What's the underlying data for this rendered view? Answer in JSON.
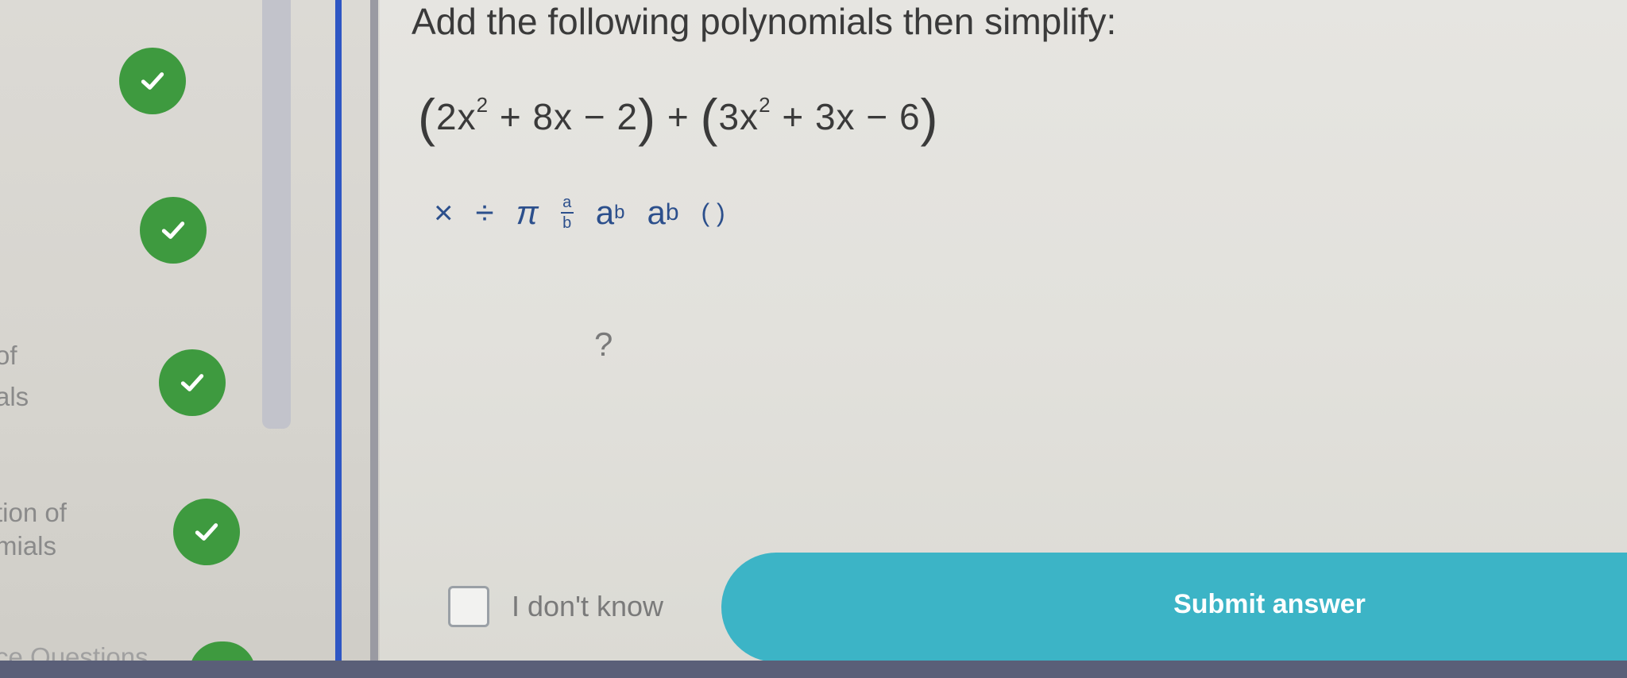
{
  "sidebar": {
    "lessons": [
      {
        "label_lines": [
          ""
        ],
        "completed": true
      },
      {
        "label_lines": [
          ""
        ],
        "completed": true
      },
      {
        "label_lines": [
          "of",
          "als"
        ],
        "completed": true
      },
      {
        "label_lines": [
          "tion of",
          "mials"
        ],
        "completed": true
      },
      {
        "label_lines": [
          "ce Questions"
        ],
        "completed": true
      }
    ]
  },
  "question": {
    "title": "Add the following polynomials then simplify:",
    "expression": {
      "p1": "2x",
      "p1_exp": "2",
      "p1_rest": "+ 8x − 2",
      "plus": "+",
      "p2": "3x",
      "p2_exp": "2",
      "p2_rest": "+ 3x − 6"
    }
  },
  "toolbar": {
    "times": "×",
    "divide": "÷",
    "pi": "π",
    "frac_num": "a",
    "frac_den": "b",
    "power_base": "a",
    "power_exp": "b",
    "sub_base": "a",
    "sub_sub": "b",
    "parens": "( )"
  },
  "answer": {
    "help_symbol": "?"
  },
  "footer": {
    "dont_know_label": "I don't know",
    "submit_label": "Submit answer"
  },
  "colors": {
    "check_green": "#3e9a3f",
    "submit_teal": "#3cb4c6",
    "divider_blue": "#2e56c4",
    "toolbar_blue": "#2c4f8c"
  }
}
